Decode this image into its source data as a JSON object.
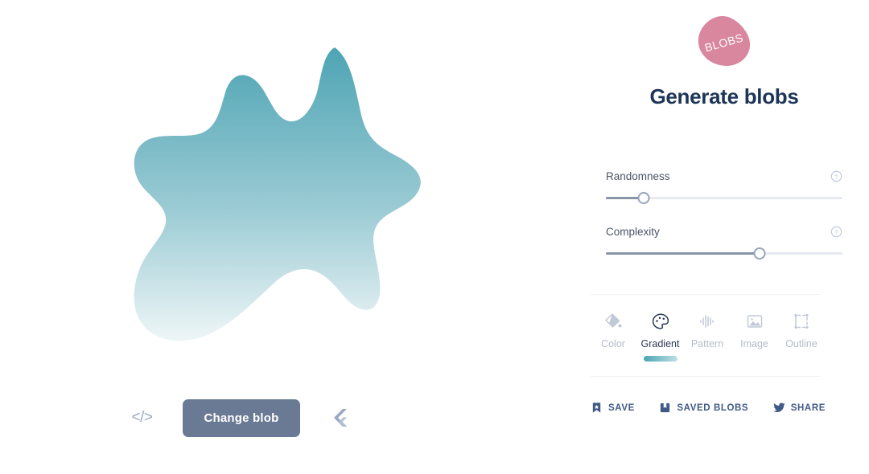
{
  "app": {
    "logo_text": "BLOBS",
    "logo_color": "#d9869f",
    "title": "Generate blobs",
    "title_color": "#1d3557",
    "accent_color": "#4ba4b4"
  },
  "canvas": {
    "blob": {
      "gradient_start": "#4ea4b4",
      "gradient_end": "#eaf4f5",
      "gradient_direction": "top-to-bottom"
    },
    "actions": {
      "code_icon": "code-icon",
      "code_label": "</>",
      "change_blob_label": "Change blob",
      "change_blob_color": "#6b7a94",
      "flutter_icon": "flutter-icon"
    }
  },
  "panel": {
    "sliders": [
      {
        "label": "Randomness",
        "value": 16,
        "min": 0,
        "max": 100,
        "help_icon": "help-circle-icon"
      },
      {
        "label": "Complexity",
        "value": 65,
        "min": 0,
        "max": 100,
        "help_icon": "help-circle-icon"
      }
    ],
    "tabs": [
      {
        "label": "Color",
        "icon": "paint-bucket-icon",
        "active": false
      },
      {
        "label": "Gradient",
        "icon": "palette-icon",
        "active": true
      },
      {
        "label": "Pattern",
        "icon": "waveform-icon",
        "active": false
      },
      {
        "label": "Image",
        "icon": "image-icon",
        "active": false
      },
      {
        "label": "Outline",
        "icon": "selection-box-icon",
        "active": false
      }
    ],
    "actions": [
      {
        "label": "SAVE",
        "icon": "bookmark-star-icon"
      },
      {
        "label": "SAVED BLOBS",
        "icon": "book-icon"
      },
      {
        "label": "SHARE",
        "icon": "twitter-icon"
      }
    ]
  }
}
